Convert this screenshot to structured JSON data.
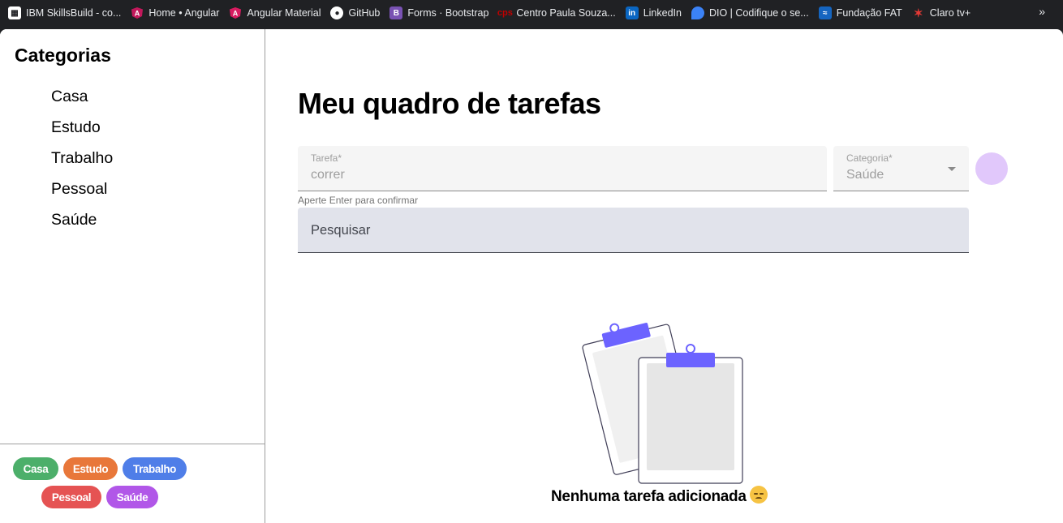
{
  "bookmarks": [
    {
      "label": "IBM SkillsBuild - co...",
      "icon": "ibm-icon",
      "color": "#ffffff"
    },
    {
      "label": "Home • Angular",
      "icon": "angular-icon",
      "color": "#e0234e"
    },
    {
      "label": "Angular Material",
      "icon": "angular-material-icon",
      "color": "#c2185b"
    },
    {
      "label": "GitHub",
      "icon": "github-icon",
      "color": "#ffffff"
    },
    {
      "label": "Forms · Bootstrap",
      "icon": "bootstrap-icon",
      "color": "#7952b3"
    },
    {
      "label": "Centro Paula Souza...",
      "icon": "cps-icon",
      "color": "#c00000"
    },
    {
      "label": "LinkedIn",
      "icon": "linkedin-icon",
      "color": "#0a66c2"
    },
    {
      "label": "DIO | Codifique o se...",
      "icon": "dio-icon",
      "color": "#3b82f6"
    },
    {
      "label": "Fundação FAT",
      "icon": "fat-icon",
      "color": "#1a73e8"
    },
    {
      "label": "Claro tv+",
      "icon": "claro-icon",
      "color": "#e53935"
    }
  ],
  "sidebar": {
    "title": "Categorias",
    "items": [
      "Casa",
      "Estudo",
      "Trabalho",
      "Pessoal",
      "Saúde"
    ],
    "chips": [
      {
        "label": "Casa",
        "color": "#4caf6a"
      },
      {
        "label": "Estudo",
        "color": "#e8773a"
      },
      {
        "label": "Trabalho",
        "color": "#4f7ee8"
      },
      {
        "label": "Pessoal",
        "color": "#e55353"
      },
      {
        "label": "Saúde",
        "color": "#b157e8"
      }
    ]
  },
  "main": {
    "title": "Meu quadro de tarefas",
    "task_field": {
      "label": "Tarefa*",
      "value": "correr"
    },
    "category_field": {
      "label": "Categoria*",
      "value": "Saúde"
    },
    "hint": "Aperte Enter para confirmar",
    "search_placeholder": "Pesquisar",
    "empty_message": "Nenhuma tarefa adicionada",
    "accent_color": "#6c63ff"
  }
}
